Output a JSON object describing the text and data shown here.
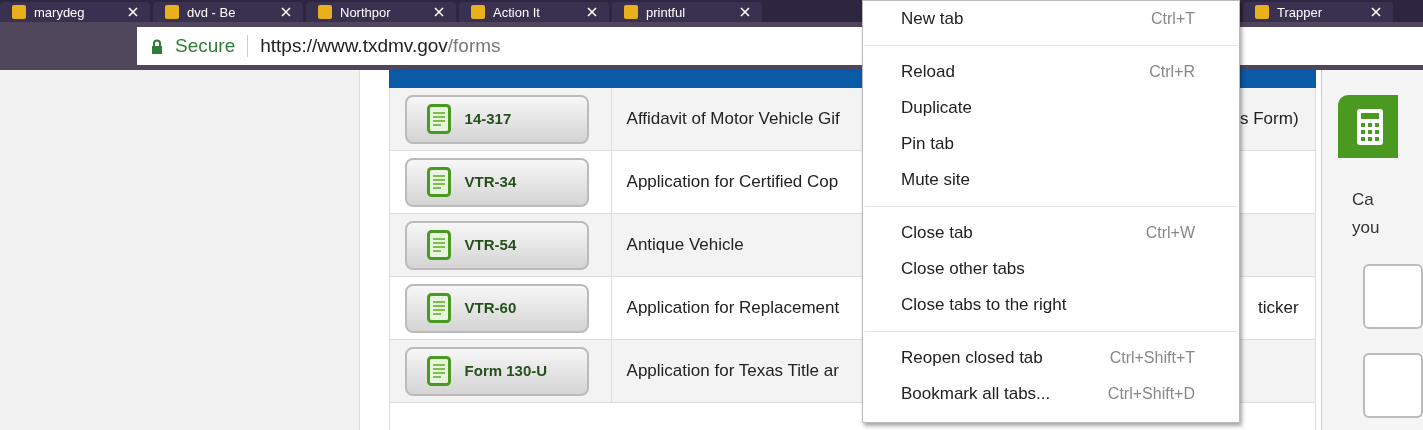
{
  "tabs": [
    {
      "title": "marydeg"
    },
    {
      "title": "dvd - Be"
    },
    {
      "title": "Northpor"
    },
    {
      "title": "Action It"
    },
    {
      "title": "printful"
    },
    {
      "title": "Trapper"
    }
  ],
  "address_bar": {
    "security": "Secure",
    "url_host": "https://www.txdmv.gov",
    "url_path": "/forms"
  },
  "table": {
    "rows": [
      {
        "form": "14-317",
        "title": "Affidavit of Motor Vehicle Gif",
        "title_end": "s Form)"
      },
      {
        "form": "VTR-34",
        "title": "Application for Certified Cop"
      },
      {
        "form": "VTR-54",
        "title": "Antique Vehicle"
      },
      {
        "form": "VTR-60",
        "title": "Application for Replacement",
        "title_end": "ticker"
      },
      {
        "form": "Form 130-U",
        "title": "Application for Texas Title ar"
      }
    ]
  },
  "sidebar": {
    "text_lines": [
      "Ca",
      "you"
    ]
  },
  "context_menu": {
    "groups": [
      [
        {
          "label": "New tab",
          "shortcut": "Ctrl+T"
        }
      ],
      [
        {
          "label": "Reload",
          "shortcut": "Ctrl+R"
        },
        {
          "label": "Duplicate"
        },
        {
          "label": "Pin tab"
        },
        {
          "label": "Mute site"
        }
      ],
      [
        {
          "label": "Close tab",
          "shortcut": "Ctrl+W"
        },
        {
          "label": "Close other tabs"
        },
        {
          "label": "Close tabs to the right"
        }
      ],
      [
        {
          "label": "Reopen closed tab",
          "shortcut": "Ctrl+Shift+T"
        },
        {
          "label": "Bookmark all tabs...",
          "shortcut": "Ctrl+Shift+D"
        }
      ]
    ]
  }
}
